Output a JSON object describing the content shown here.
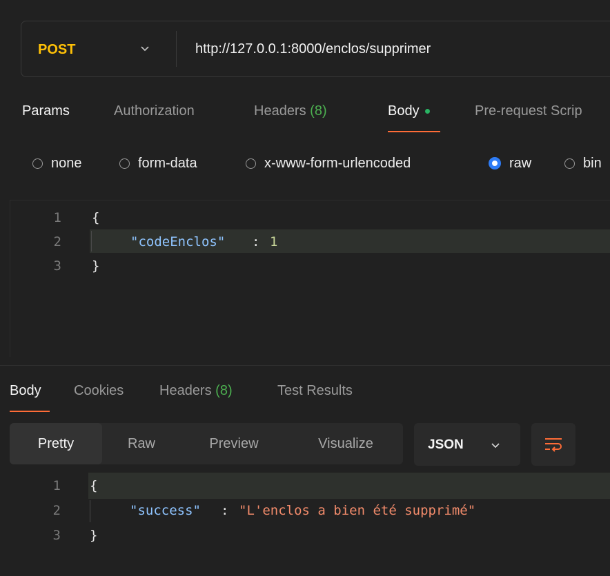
{
  "request": {
    "method": "POST",
    "url": "http://127.0.0.1:8000/enclos/supprimer"
  },
  "request_tabs": [
    {
      "label": "Params"
    },
    {
      "label": "Authorization"
    },
    {
      "label": "Headers",
      "count": "(8)"
    },
    {
      "label": "Body"
    },
    {
      "label": "Pre-request Scrip"
    }
  ],
  "body_types": [
    {
      "label": "none",
      "checked": false
    },
    {
      "label": "form-data",
      "checked": false
    },
    {
      "label": "x-www-form-urlencoded",
      "checked": false
    },
    {
      "label": "raw",
      "checked": true
    },
    {
      "label": "bin",
      "checked": false
    }
  ],
  "request_body": {
    "line_numbers": [
      "1",
      "2",
      "3"
    ],
    "open_brace": "{",
    "key": "\"codeEnclos\"",
    "colon": ":",
    "value": "1",
    "close_brace": "}"
  },
  "response_tabs": [
    {
      "label": "Body"
    },
    {
      "label": "Cookies"
    },
    {
      "label": "Headers",
      "count": "(8)"
    },
    {
      "label": "Test Results"
    }
  ],
  "view_modes": [
    "Pretty",
    "Raw",
    "Preview",
    "Visualize"
  ],
  "format": {
    "selected": "JSON"
  },
  "response_body": {
    "line_numbers": [
      "1",
      "2",
      "3"
    ],
    "open_brace": "{",
    "key": "\"success\"",
    "colon": ":",
    "value": "\"L'enclos a bien été supprimé\"",
    "close_brace": "}"
  },
  "colors": {
    "accent": "#ff6c37",
    "method": "#ffc107",
    "count": "#4caf50",
    "radio_checked": "#2e7cf6"
  },
  "icons": [
    "chevron-down-icon",
    "wrap-lines-icon"
  ]
}
